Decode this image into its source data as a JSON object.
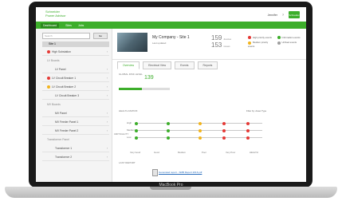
{
  "device_label": "MacBook Pro",
  "app": {
    "brand_line1": "Schneider",
    "brand_line2": "Power Advisor",
    "user": "Jennifer",
    "se_logo": "Schneider",
    "nav": [
      "Dashboard",
      "Sites",
      "Jobs"
    ]
  },
  "sidebar": {
    "search_placeholder": "Search",
    "search_button": "Go",
    "site": "Site 1",
    "items": [
      {
        "label": "High Substation",
        "dot": "#e53935"
      },
      {
        "label": "LV Boards",
        "group": true
      },
      {
        "label": "LV Panel"
      },
      {
        "label": "LV Circuit Breaker 1",
        "dot": "#e53935"
      },
      {
        "label": "LV Circuit Breaker 2",
        "dot": "#f2b41c"
      },
      {
        "label": "LV Circuit Breaker 3"
      },
      {
        "label": "MV Boards",
        "group": true
      },
      {
        "label": "MV Panel"
      },
      {
        "label": "MV Feeder Panel 1"
      },
      {
        "label": "MV Feeder Panel 2"
      },
      {
        "label": "Transformer Panel",
        "group": true
      },
      {
        "label": "Transformer 1"
      },
      {
        "label": "Transformer 2"
      }
    ]
  },
  "site_header": {
    "title": "My Company - Site 1",
    "subtitle": "Last updated",
    "stat1": "159",
    "stat1_label": "devices",
    "stat2": "153",
    "stat2_label": "issues"
  },
  "legend": [
    {
      "label": "High priority events",
      "color": "#e53935"
    },
    {
      "label": "Information events",
      "color": "#3dae2b"
    },
    {
      "label": "Medium priority events",
      "color": "#f2b41c"
    },
    {
      "label": "Unfixed events",
      "color": "#9e9e9e"
    }
  ],
  "tabs": [
    "Overview",
    "Electrical View",
    "Events",
    "Reports"
  ],
  "overview": {
    "global_label": "GLOBAL RISK LEVEL",
    "gauge_value": "139",
    "gauge_percent": 45,
    "health_label": "HEALTH MATRIX",
    "health_select": "Filter by: Asset Type",
    "criticality_label": "CRITICALITY",
    "rows": [
      "High",
      "Medium",
      "Low"
    ],
    "axis": [
      "Very Good",
      "Good",
      "Medium",
      "Poor",
      "Very Poor",
      "HEALTH"
    ],
    "last_report_label": "LAST REPORT",
    "report_link": "Generated report - SMB Report 2016.pdf"
  }
}
